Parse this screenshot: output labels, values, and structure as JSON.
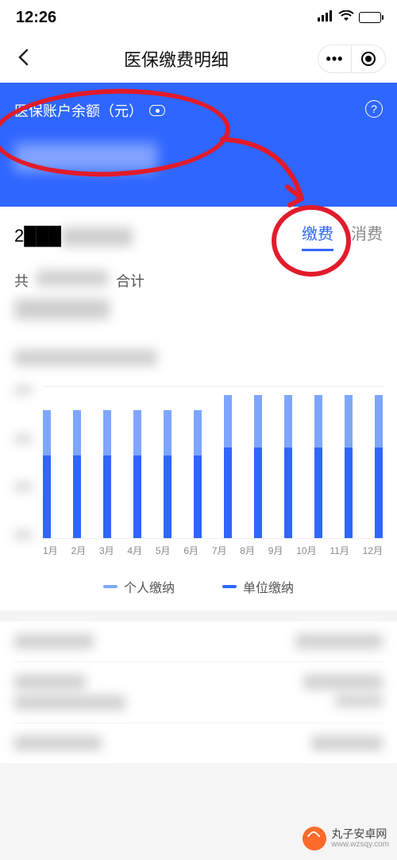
{
  "status": {
    "time": "12:26"
  },
  "nav": {
    "title": "医保缴费明细",
    "menu_label": "•••"
  },
  "card": {
    "balance_label": "医保账户余额（元）",
    "help_symbol": "?",
    "balance_value": "████████"
  },
  "filter": {
    "year": "2███",
    "tab_pay": "缴费",
    "tab_spend": "消费"
  },
  "summary": {
    "prefix": "共",
    "label": "合计",
    "value": "████████"
  },
  "chart_data": {
    "type": "bar",
    "categories": [
      "1月",
      "2月",
      "3月",
      "4月",
      "5月",
      "6月",
      "7月",
      "8月",
      "9月",
      "10月",
      "11月",
      "12月"
    ],
    "series": [
      {
        "name": "个人缴纳",
        "color": "#7ea6ff",
        "values": [
          30,
          30,
          30,
          30,
          30,
          30,
          35,
          35,
          35,
          35,
          35,
          35
        ]
      },
      {
        "name": "单位缴纳",
        "color": "#2f66ff",
        "values": [
          55,
          55,
          55,
          55,
          55,
          55,
          60,
          60,
          60,
          60,
          60,
          60
        ]
      }
    ],
    "ylim": [
      0,
      100
    ],
    "y_ticks": [
      "",
      "",
      "",
      ""
    ]
  },
  "legend": {
    "personal": "个人缴纳",
    "employer": "单位缴纳"
  },
  "watermark": {
    "brand": "丸子安卓网",
    "url": "www.wzsqy.com"
  }
}
